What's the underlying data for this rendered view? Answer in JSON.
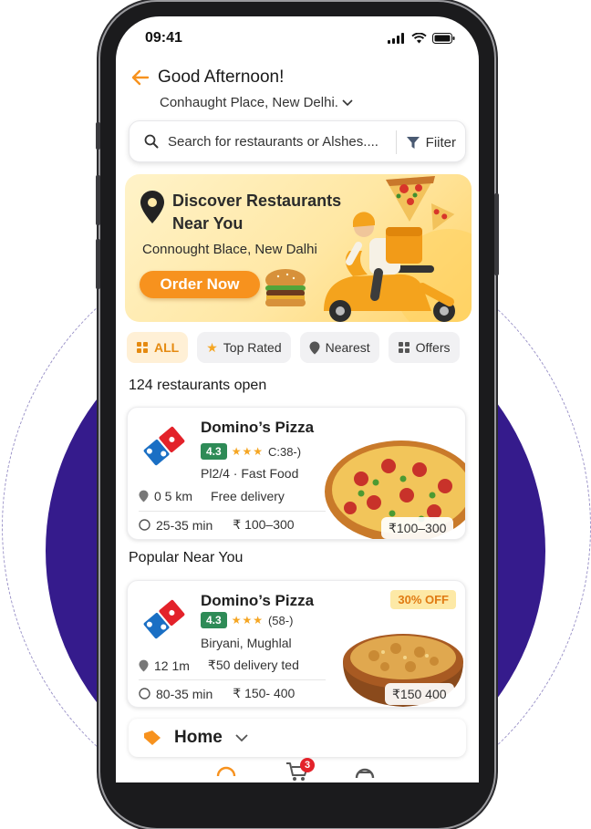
{
  "status_bar": {
    "time": "09:41"
  },
  "header": {
    "greeting": "Good Afternoon!",
    "location": "Conhaught Place, New Delhi."
  },
  "search": {
    "placeholder": "Search for restaurants or Alshes....",
    "filter_label": "Fiiter"
  },
  "banner": {
    "title": "Discover Restaurants Near You",
    "subtitle": "Connought Blace, New Dalhi",
    "cta_label": "Order Now"
  },
  "chips": [
    {
      "label": "ALL",
      "icon": "all-grid-icon",
      "active": true
    },
    {
      "label": "Top Rated",
      "icon": "star-icon",
      "active": false
    },
    {
      "label": "Nearest",
      "icon": "location-pin-icon",
      "active": false
    },
    {
      "label": "Offers",
      "icon": "grid-icon",
      "active": false
    }
  ],
  "open_count_text": "124 restaurants open",
  "popular_title": "Popular Near You",
  "cards": [
    {
      "name": "Domino’s Pizza",
      "rating": "4.3",
      "stars": "★★★",
      "reviews": "C:38-)",
      "cuisine": "Pl2/4 · Fast Food",
      "distance": "0 5 km",
      "delivery": "Free delivery",
      "time": "25-35 min",
      "price_range": "₹ 100–300",
      "price_overlay": "₹100–300",
      "discount": ""
    },
    {
      "name": "Domino’s Pizza",
      "rating": "4.3",
      "stars": "★★★",
      "reviews": "(58-)",
      "cuisine": "Biryani, Mughlal",
      "distance": "12 1m",
      "delivery": "₹50 delivery ted",
      "time": "80-35 min",
      "price_range": "₹ 150- 400",
      "price_overlay": "₹150 400",
      "discount": "30% OFF"
    }
  ],
  "home_label": "Home",
  "cart_count": "3",
  "colors": {
    "accent": "#f7921e",
    "rating_green": "#2e8b57",
    "brand_purple": "#351b8c"
  }
}
